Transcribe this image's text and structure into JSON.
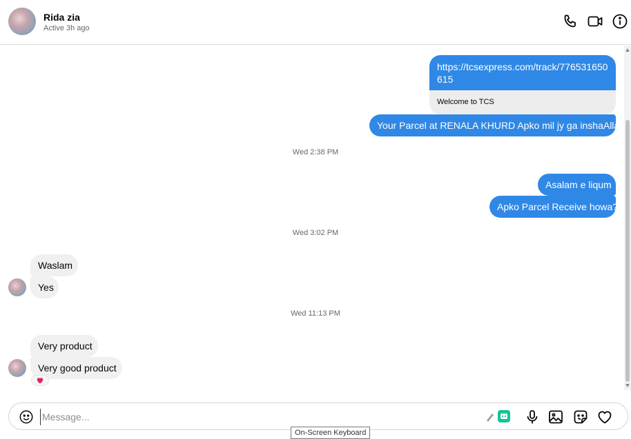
{
  "header": {
    "name": "Rida zia",
    "status": "Active 3h ago"
  },
  "messages": {
    "link_url": "https://tcsexpress.com/track/776531650615",
    "link_title": "Welcome to TCS",
    "msg1": "Your Parcel at RENALA KHURD Apko mil jy ga inshaAllah",
    "time1": "Wed 2:38 PM",
    "msg2": "Asalam e liqum",
    "msg3": "Apko Parcel Receive howa?",
    "time2": "Wed 3:02 PM",
    "msg4": "Waslam",
    "msg5": "Yes",
    "time3": "Wed 11:13 PM",
    "msg6": "Very product",
    "msg7": "Very good product",
    "reaction": "heart-icon"
  },
  "composer": {
    "placeholder": "Message...",
    "value": ""
  },
  "tooltip": "On-Screen Keyboard",
  "colors": {
    "outgoing_bubble": "#2f88e6",
    "incoming_bubble": "#f0f0f0",
    "reaction_heart": "#e0245e"
  }
}
